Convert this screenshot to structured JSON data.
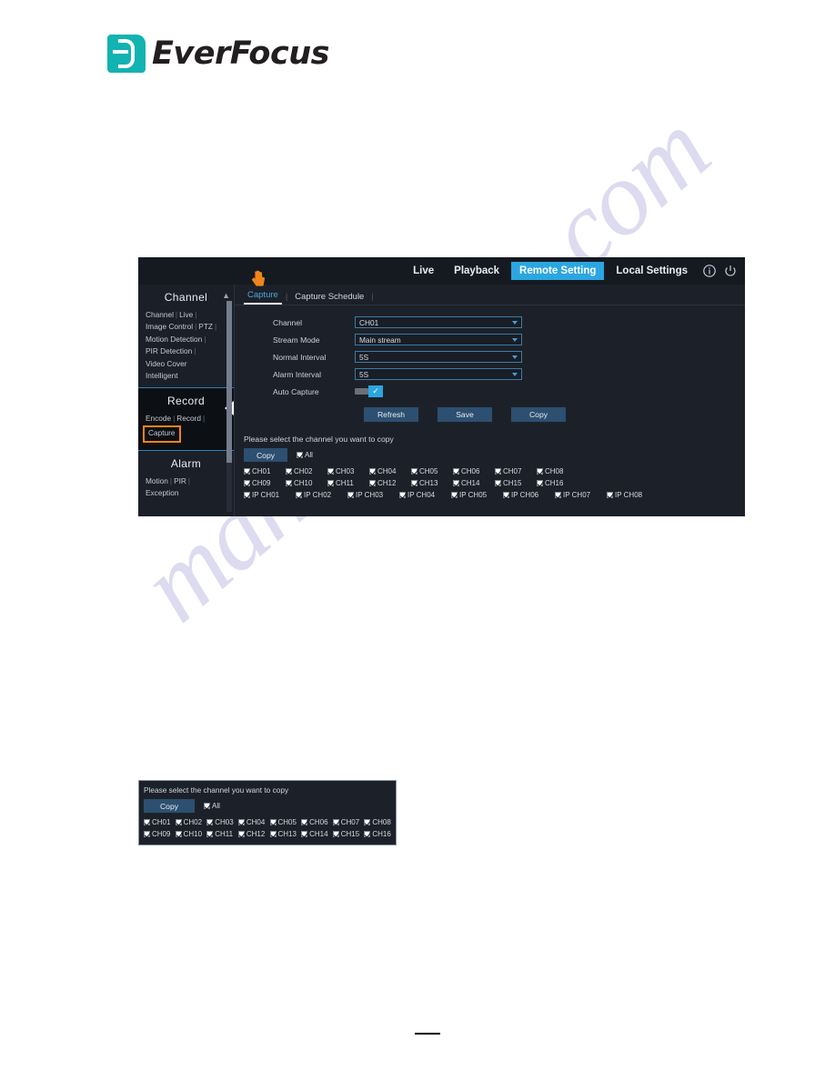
{
  "logo": {
    "wordmark": "EverFocus"
  },
  "watermark": {
    "text": "manualshive.com"
  },
  "ui": {
    "topbar": {
      "items": [
        {
          "label": "Live",
          "active": false
        },
        {
          "label": "Playback",
          "active": false
        },
        {
          "label": "Remote Setting",
          "active": true
        },
        {
          "label": "Local Settings",
          "active": false
        }
      ],
      "icons": [
        {
          "name": "info-icon",
          "glyph": "i"
        },
        {
          "name": "power-icon",
          "glyph": "power"
        }
      ],
      "accent_color": "#2ba6e0"
    },
    "sidebar": {
      "sections": [
        {
          "title": "Channel",
          "rows": [
            [
              "Channel",
              "Live"
            ],
            [
              "Image Control",
              "PTZ"
            ],
            [
              "Motion Detection"
            ],
            [
              "PIR Detection"
            ],
            [
              "Video Cover"
            ],
            [
              "Intelligent"
            ]
          ]
        },
        {
          "title": "Record",
          "rows": [
            [
              "Encode",
              "Record"
            ]
          ],
          "highlighted_item": "Capture",
          "highlight_color": "#f08519",
          "active": true
        },
        {
          "title": "Alarm",
          "rows": [
            [
              "Motion",
              "PIR"
            ],
            [
              "Exception"
            ]
          ]
        }
      ]
    },
    "tabs": [
      {
        "label": "Capture",
        "active": true
      },
      {
        "label": "Capture Schedule",
        "active": false
      }
    ],
    "form": {
      "rows": [
        {
          "label": "Channel",
          "value": "CH01",
          "type": "select"
        },
        {
          "label": "Stream Mode",
          "value": "Main stream",
          "type": "select"
        },
        {
          "label": "Normal Interval",
          "value": "5S",
          "type": "select"
        },
        {
          "label": "Alarm Interval",
          "value": "5S",
          "type": "select"
        },
        {
          "label": "Auto Capture",
          "value": "on",
          "type": "toggle"
        }
      ],
      "buttons": [
        {
          "label": "Refresh"
        },
        {
          "label": "Save"
        },
        {
          "label": "Copy"
        }
      ]
    },
    "copy_section": {
      "title": "Please select the channel you want to copy",
      "copy_button": "Copy",
      "all_label": "All",
      "rows": [
        [
          "CH01",
          "CH02",
          "CH03",
          "CH04",
          "CH05",
          "CH06",
          "CH07",
          "CH08"
        ],
        [
          "CH09",
          "CH10",
          "CH11",
          "CH12",
          "CH13",
          "CH14",
          "CH15",
          "CH16"
        ],
        [
          "IP CH01",
          "IP CH02",
          "IP CH03",
          "IP CH04",
          "IP CH05",
          "IP CH06",
          "IP CH07",
          "IP CH08"
        ]
      ]
    }
  },
  "inset": {
    "title": "Please select the channel you want to copy",
    "copy_button": "Copy",
    "all_label": "All",
    "rows": [
      [
        "CH01",
        "CH02",
        "CH03",
        "CH04",
        "CH05",
        "CH06",
        "CH07",
        "CH08"
      ],
      [
        "CH09",
        "CH10",
        "CH11",
        "CH12",
        "CH13",
        "CH14",
        "CH15",
        "CH16"
      ]
    ]
  }
}
